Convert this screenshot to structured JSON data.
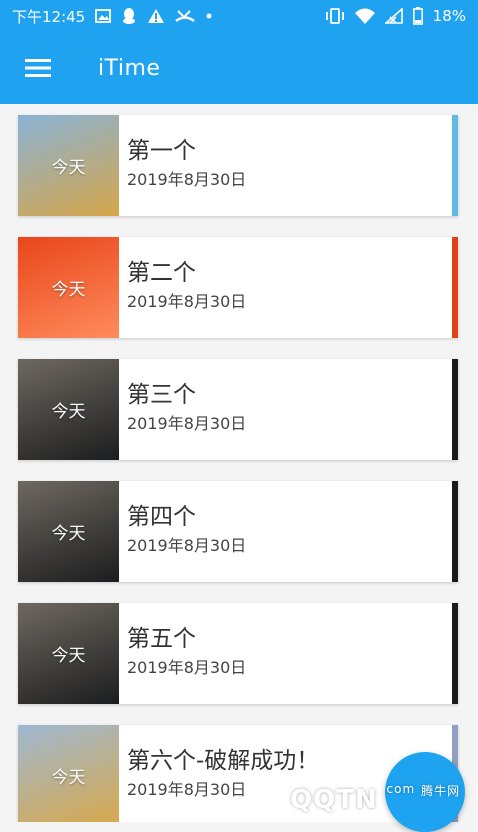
{
  "status_bar": {
    "time": "下午12:45",
    "battery": "18%",
    "icons": [
      "image-icon",
      "qq-icon",
      "warning-icon",
      "missed-call-icon",
      "dot-icon",
      "vibrate-icon",
      "wifi-icon",
      "signal-icon",
      "battery-icon"
    ]
  },
  "app_bar": {
    "title": "iTime",
    "menu_icon": "hamburger-icon"
  },
  "cards": [
    {
      "thumb_label": "今天",
      "title": "第一个",
      "date": "2019年8月30日",
      "accent": "#5fbbe3",
      "thumb_colors": [
        "#8ab3d6",
        "#d6a64a"
      ]
    },
    {
      "thumb_label": "今天",
      "title": "第二个",
      "date": "2019年8月30日",
      "accent": "#e0421b",
      "thumb_colors": [
        "#e8461b",
        "#ff8b5c"
      ]
    },
    {
      "thumb_label": "今天",
      "title": "第三个",
      "date": "2019年8月30日",
      "accent": "#1b1b1b",
      "thumb_colors": [
        "#6e6860",
        "#1c1d1f"
      ]
    },
    {
      "thumb_label": "今天",
      "title": "第四个",
      "date": "2019年8月30日",
      "accent": "#1b1b1b",
      "thumb_colors": [
        "#6e6860",
        "#1c1d1f"
      ]
    },
    {
      "thumb_label": "今天",
      "title": "第五个",
      "date": "2019年8月30日",
      "accent": "#1b1b1b",
      "thumb_colors": [
        "#6e6860",
        "#1c1d1f"
      ]
    },
    {
      "thumb_label": "今天",
      "title": "第六个-破解成功！",
      "date": "2019年8月30日",
      "accent": "#8fa0c0",
      "thumb_colors": [
        "#9fb8d2",
        "#d8a84a"
      ]
    }
  ],
  "watermark": {
    "main": "QQTN",
    "suffix": ".com",
    "tag": "腾牛网"
  },
  "colors": {
    "primary": "#1fa3f1"
  }
}
